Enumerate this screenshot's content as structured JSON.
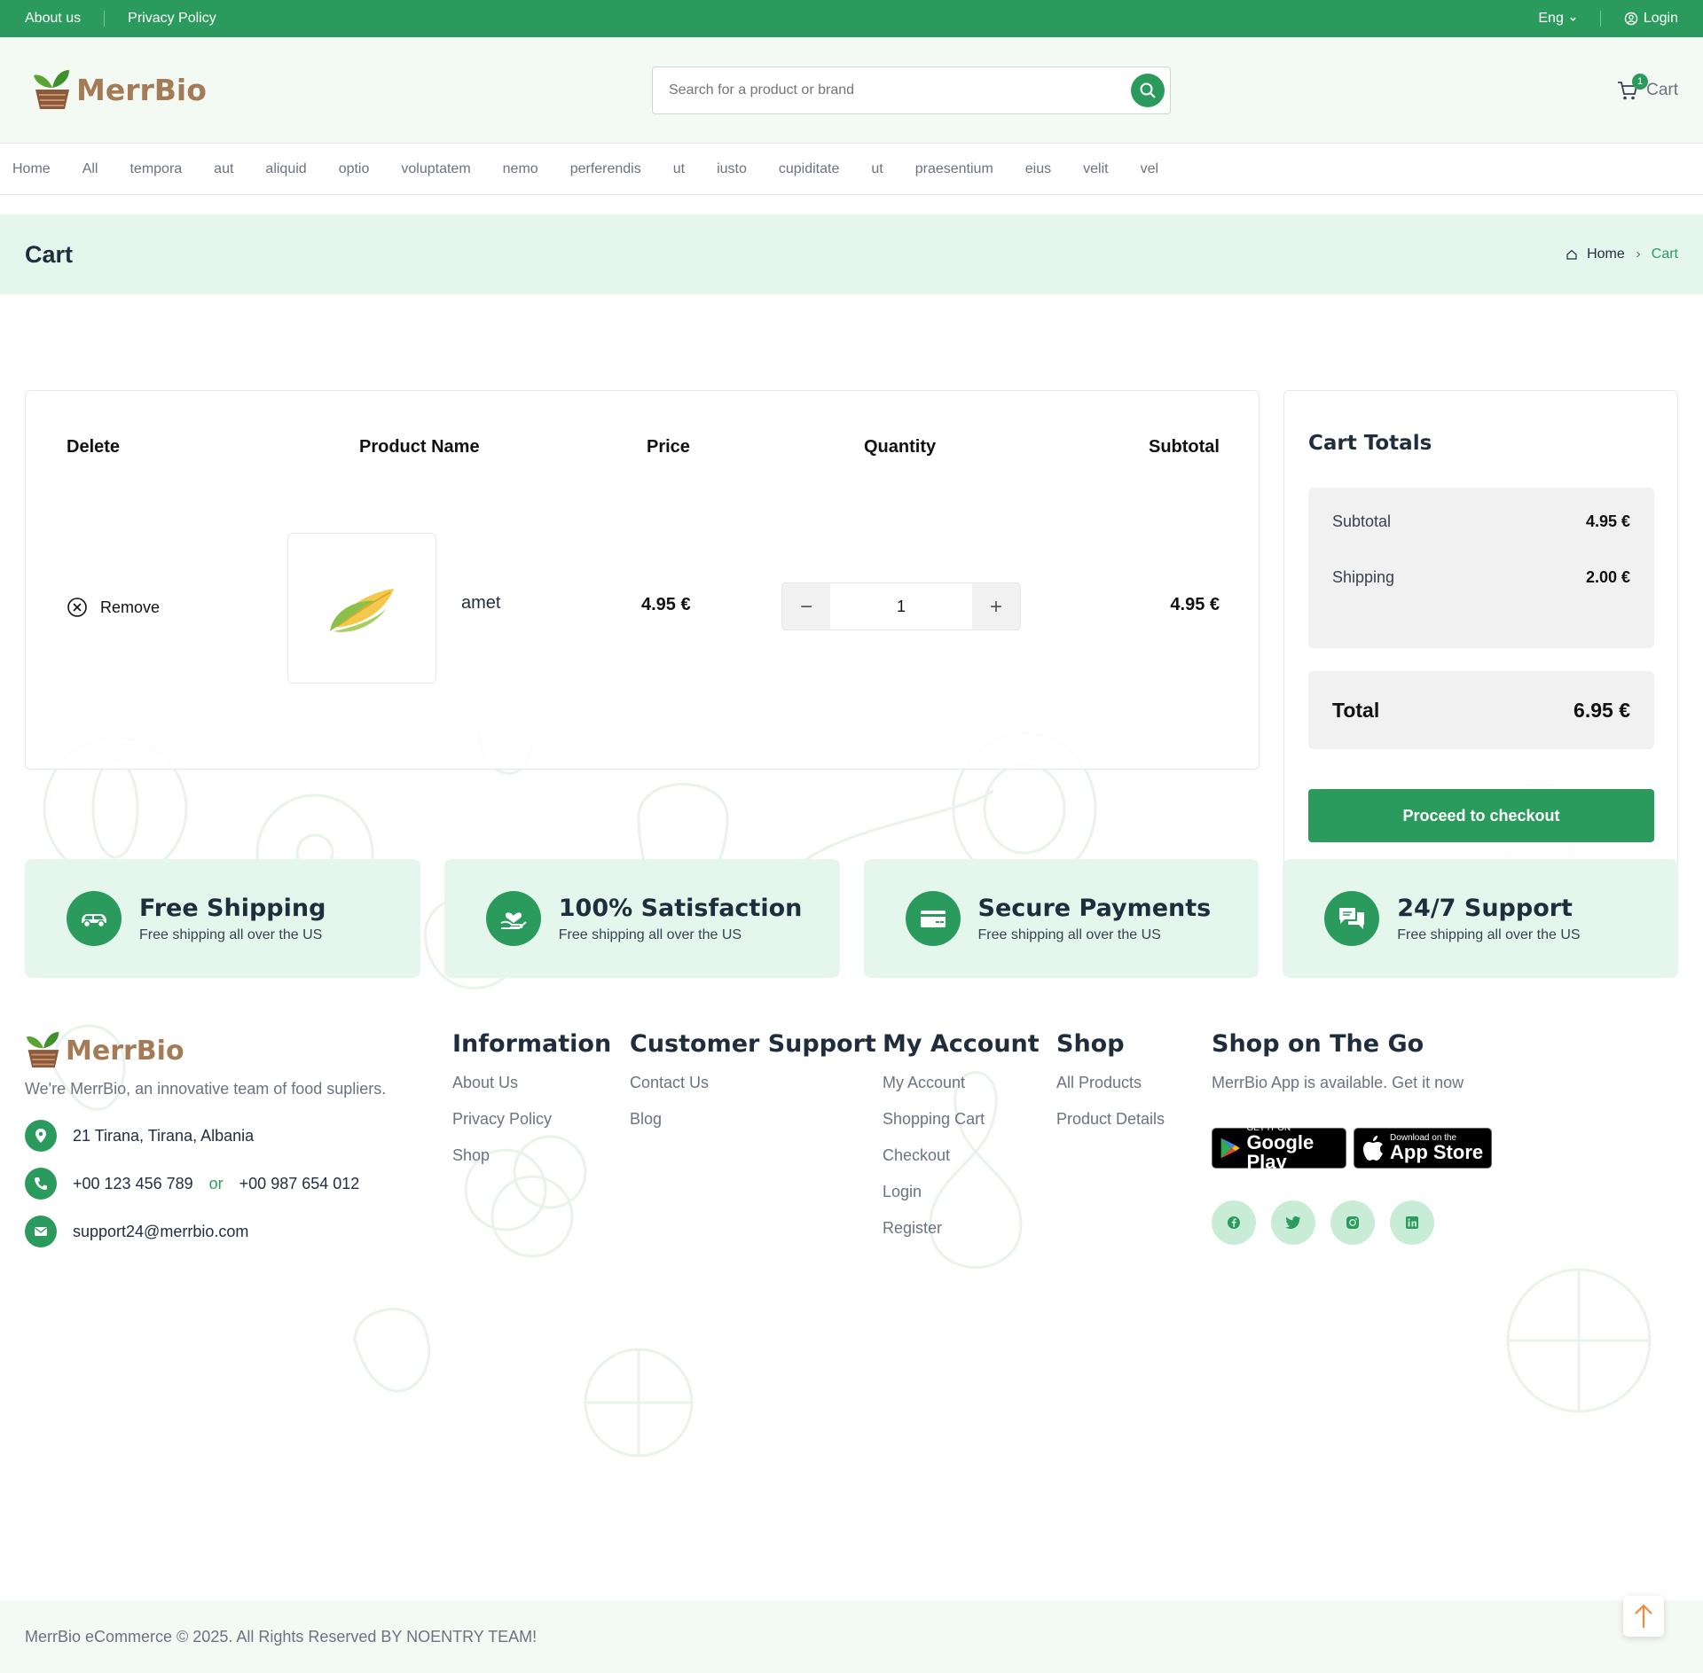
{
  "topbar": {
    "about": "About us",
    "privacy": "Privacy Policy",
    "language": "Eng",
    "login": "Login"
  },
  "brand": {
    "name": "MerrBio"
  },
  "search": {
    "placeholder": "Search for a product or brand"
  },
  "cart": {
    "label": "Cart",
    "count": "1"
  },
  "nav": [
    "Home",
    "All",
    "tempora",
    "aut",
    "aliquid",
    "optio",
    "voluptatem",
    "nemo",
    "perferendis",
    "ut",
    "iusto",
    "cupiditate",
    "ut",
    "praesentium",
    "eius",
    "velit",
    "vel"
  ],
  "page": {
    "title": "Cart",
    "breadcrumb": {
      "home": "Home",
      "current": "Cart"
    }
  },
  "table": {
    "headers": {
      "delete": "Delete",
      "product": "Product Name",
      "price": "Price",
      "quantity": "Quantity",
      "subtotal": "Subtotal"
    },
    "rows": [
      {
        "remove": "Remove",
        "name": "amet",
        "price": "4.95 €",
        "quantity": "1",
        "subtotal": "4.95 €",
        "qty_minus": "−",
        "qty_plus": "+"
      }
    ]
  },
  "totals": {
    "title": "Cart Totals",
    "subtotal_label": "Subtotal",
    "subtotal_value": "4.95 €",
    "shipping_label": "Shipping",
    "shipping_value": "2.00 €",
    "total_label": "Total",
    "total_value": "6.95 €",
    "checkout": "Proceed to checkout"
  },
  "features": [
    {
      "title": "Free Shipping",
      "sub": "Free shipping all over the US",
      "icon": "truck-icon"
    },
    {
      "title": "100% Satisfaction",
      "sub": "Free shipping all over the US",
      "icon": "hand-heart-icon"
    },
    {
      "title": "Secure Payments",
      "sub": "Free shipping all over the US",
      "icon": "credit-card-icon"
    },
    {
      "title": "24/7 Support",
      "sub": "Free shipping all over the US",
      "icon": "chat-icon"
    }
  ],
  "footer": {
    "tagline": "We're MerrBio, an innovative team of food supliers.",
    "address": "21 Tirana, Tirana, Albania",
    "phone1": "+00 123 456 789",
    "phone_or": "or",
    "phone2": "+00 987 654 012",
    "email": "support24@merrbio.com",
    "information": {
      "title": "Information",
      "links": [
        "About Us",
        "Privacy Policy",
        "Shop"
      ]
    },
    "support": {
      "title": "Customer Support",
      "links": [
        "Contact Us",
        "Blog"
      ]
    },
    "account": {
      "title": "My Account",
      "links": [
        "My Account",
        "Shopping Cart",
        "Checkout",
        "Login",
        "Register"
      ]
    },
    "shop": {
      "title": "Shop",
      "links": [
        "All Products",
        "Product Details"
      ]
    },
    "app": {
      "title": "Shop on The Go",
      "text": "MerrBio App is available. Get it now",
      "google_small": "GET IT ON",
      "google_big": "Google Play",
      "apple_small": "Download on the",
      "apple_big": "App Store"
    },
    "social": [
      "facebook-icon",
      "twitter-icon",
      "instagram-icon",
      "linkedin-icon"
    ]
  },
  "copyright": "MerrBio eCommerce © 2025. All Rights Reserved BY NOENTRY TEAM!",
  "colors": {
    "primary": "#2b9b5d",
    "light_green": "#e5f7ec",
    "brand_brown": "#a57a56"
  }
}
